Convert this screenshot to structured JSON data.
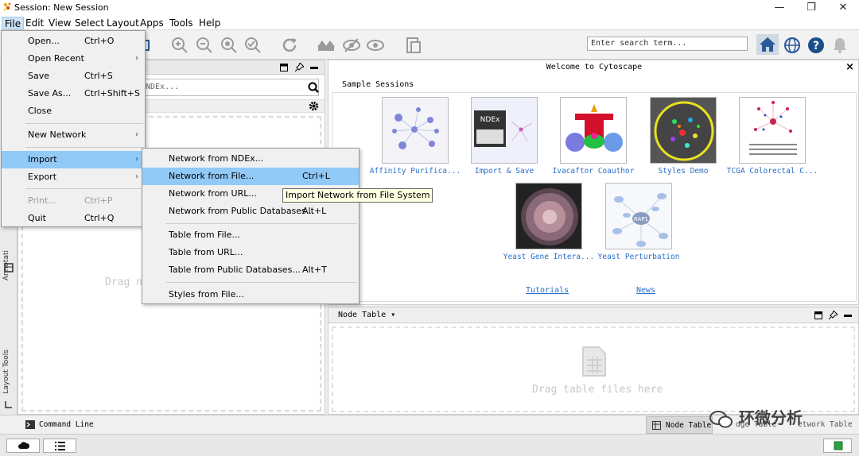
{
  "window": {
    "title": "Session: New Session",
    "minimize": "—",
    "maximize": "❐",
    "close": "✕"
  },
  "menubar": [
    "File",
    "Edit",
    "View",
    "Select",
    "Layout",
    "Apps",
    "Tools",
    "Help"
  ],
  "toolbar": {
    "search_placeholder": "Enter search term..."
  },
  "file_menu": {
    "items": [
      {
        "label": "Open...",
        "shortcut": "Ctrl+O"
      },
      {
        "label": "Open Recent",
        "shortcut": ""
      },
      {
        "label": "Save",
        "shortcut": "Ctrl+S"
      },
      {
        "label": "Save As...",
        "shortcut": "Ctrl+Shift+S"
      },
      {
        "label": "Close",
        "shortcut": ""
      },
      {
        "label": "New Network",
        "shortcut": ""
      },
      {
        "label": "Import",
        "shortcut": ""
      },
      {
        "label": "Export",
        "shortcut": ""
      },
      {
        "label": "Print...",
        "shortcut": "Ctrl+P"
      },
      {
        "label": "Quit",
        "shortcut": "Ctrl+Q"
      }
    ]
  },
  "import_menu": {
    "items": [
      {
        "label": "Network from NDEx...",
        "shortcut": ""
      },
      {
        "label": "Network from File...",
        "shortcut": "Ctrl+L"
      },
      {
        "label": "Network from URL...",
        "shortcut": ""
      },
      {
        "label": "Network from Public Databases...",
        "shortcut": "Alt+L"
      },
      {
        "label": "Table from File...",
        "shortcut": ""
      },
      {
        "label": "Table from URL...",
        "shortcut": ""
      },
      {
        "label": "Table from Public Databases...",
        "shortcut": "Alt+T"
      },
      {
        "label": "Styles from File...",
        "shortcut": ""
      }
    ]
  },
  "tooltip": "Import Network from File System",
  "left_panel": {
    "search_fragment": "NDEx...",
    "drag_text": "Drag ne",
    "annotation_tab": "Annotati",
    "layout_tools_tab": "Layout Tools"
  },
  "welcome": {
    "title": "Welcome to Cytoscape",
    "close": "×",
    "sample_sessions_label": "Sample Sessions",
    "sessions": [
      {
        "caption": "Affinity Purifica..."
      },
      {
        "caption": "Import & Save"
      },
      {
        "caption": "Ivacaftor Coauthor"
      },
      {
        "caption": "Styles Demo"
      },
      {
        "caption": "TCGA Colorectal C..."
      },
      {
        "caption": "Yeast Gene Intera..."
      },
      {
        "caption": "Yeast Perturbation"
      }
    ],
    "thumb_text": {
      "ndex": "NDEx",
      "rap1": "RAP1"
    },
    "tutorials": "Tutorials",
    "news": "News"
  },
  "table_panel": {
    "title": "Node Table",
    "drag_text": "Drag table files here",
    "tab_node": "Node Table",
    "tab_edge_fragment": "dge Table",
    "tab_network_fragment": "etwork Table"
  },
  "command_line": {
    "label": "Command Line"
  },
  "watermark": "环微分析",
  "colors": {
    "link": "#2a6fc9",
    "highlight": "#91c9f7",
    "tooltip_bg": "#ffffe1"
  }
}
